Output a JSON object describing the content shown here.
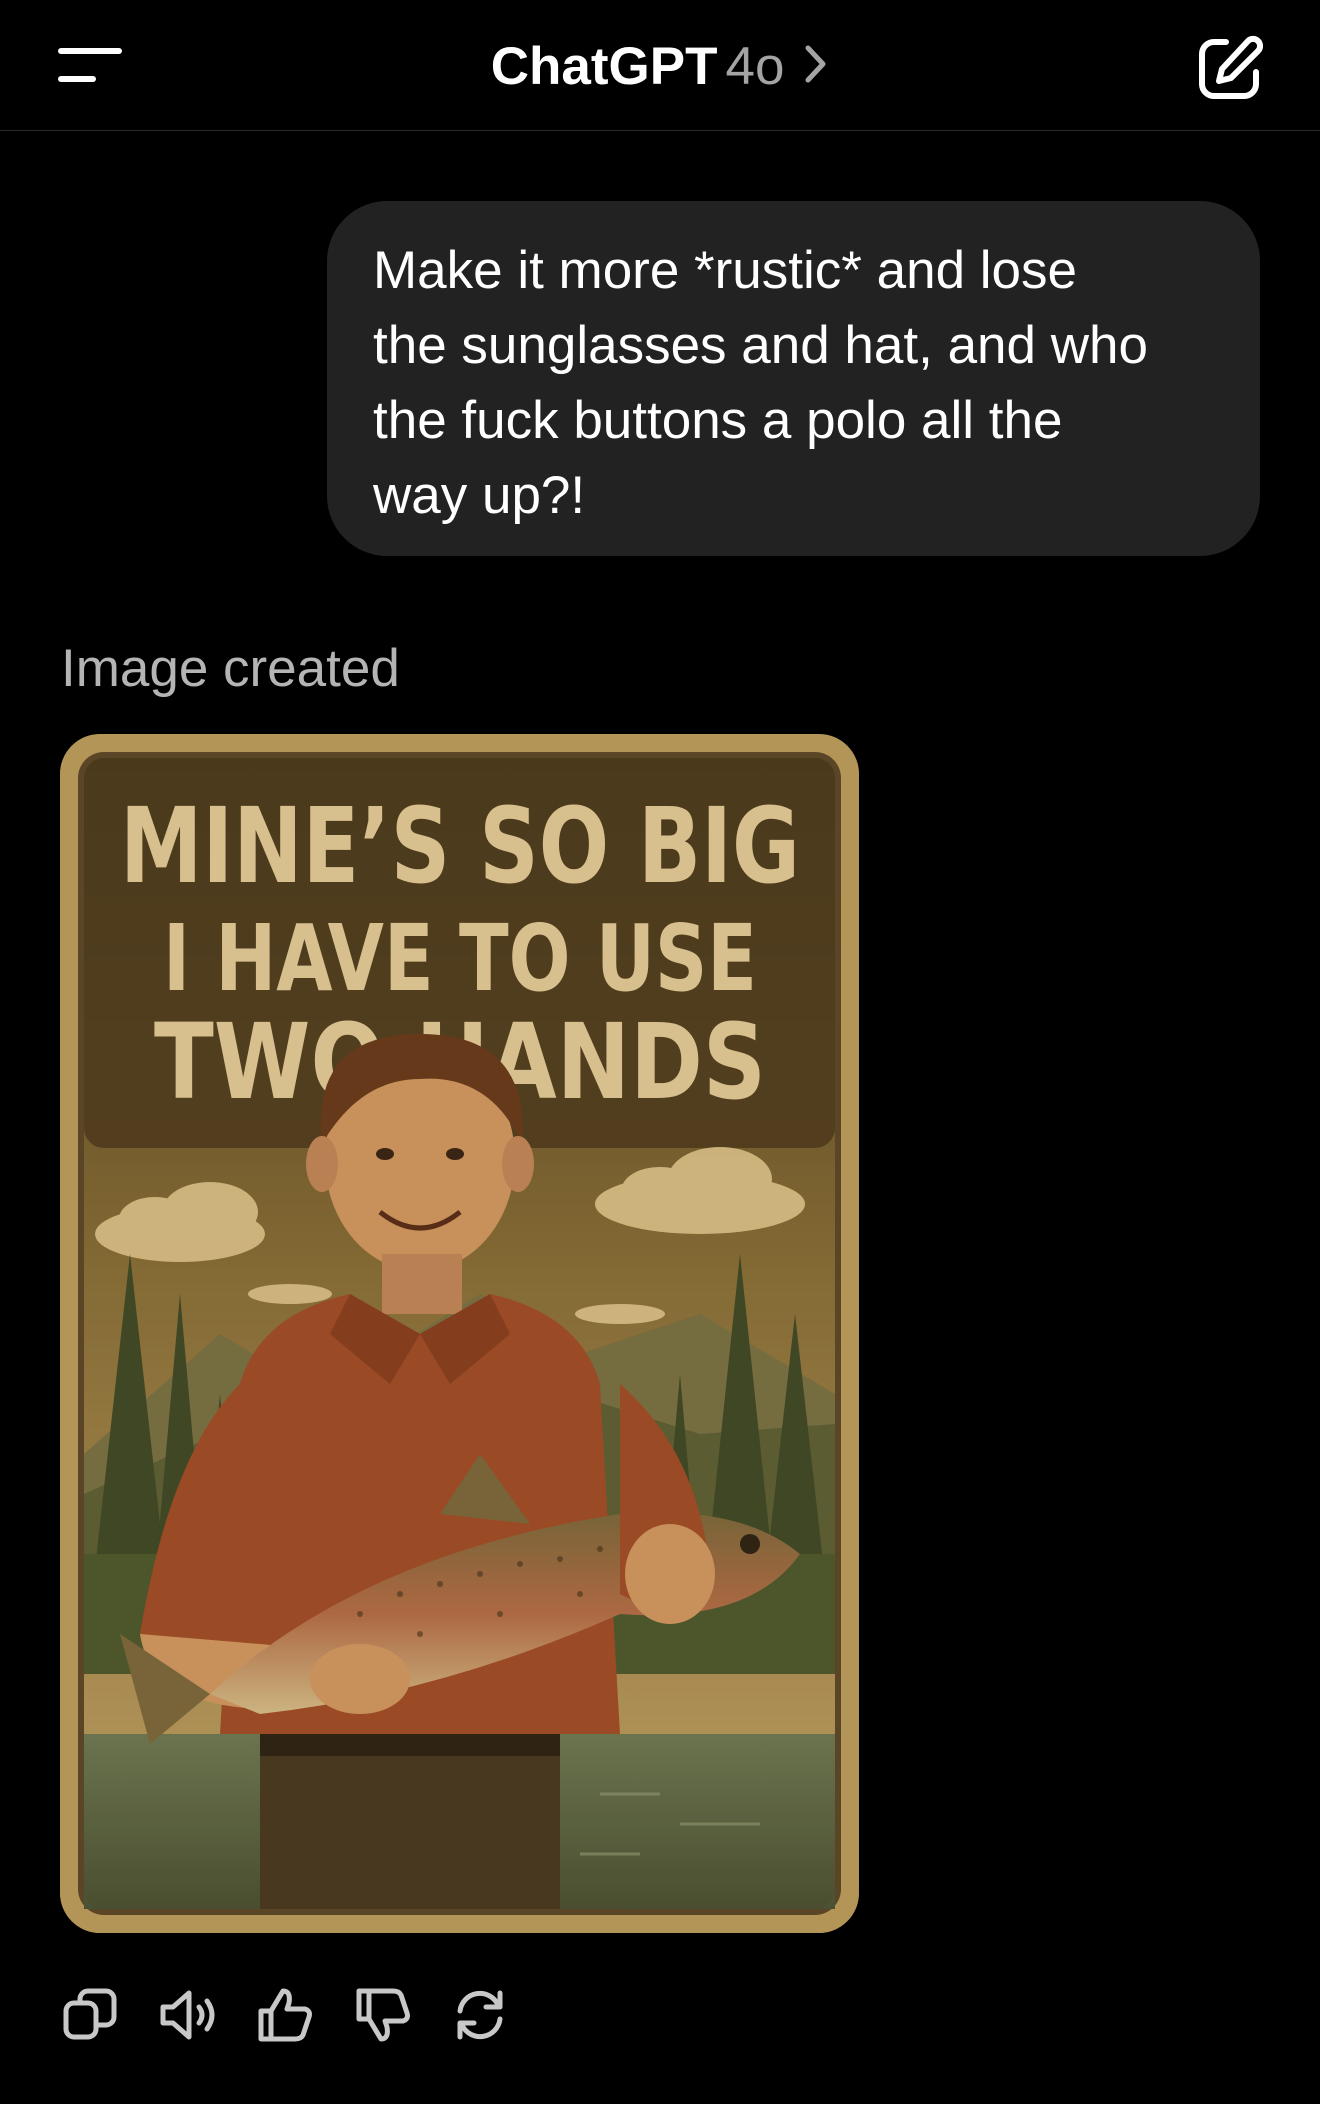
{
  "header": {
    "title": "ChatGPT",
    "model": "4o",
    "icons": {
      "menu": "menu-icon",
      "chevron": "chevron-right-icon",
      "new_chat": "compose-icon"
    }
  },
  "conversation": {
    "user_message": {
      "lines": [
        "Make it more *rustic* and lose",
        "the sunglasses and hat, and who",
        "the fuck buttons a polo all the",
        "way up?!"
      ]
    },
    "assistant": {
      "status": "Image created",
      "poster": {
        "headline_lines": [
          "MINE’S SO BIG",
          "I HAVE TO USE",
          "TWO HANDS"
        ]
      },
      "actions": [
        "copy-icon",
        "read-aloud-icon",
        "thumbs-up-icon",
        "thumbs-down-icon",
        "regenerate-icon"
      ]
    }
  },
  "colors": {
    "background": "#000000",
    "bubble": "#222222",
    "muted_text": "#b4b4b4",
    "poster_border": "#b39558",
    "poster_ink": "#5a4626",
    "headline": "#e5cd99"
  }
}
